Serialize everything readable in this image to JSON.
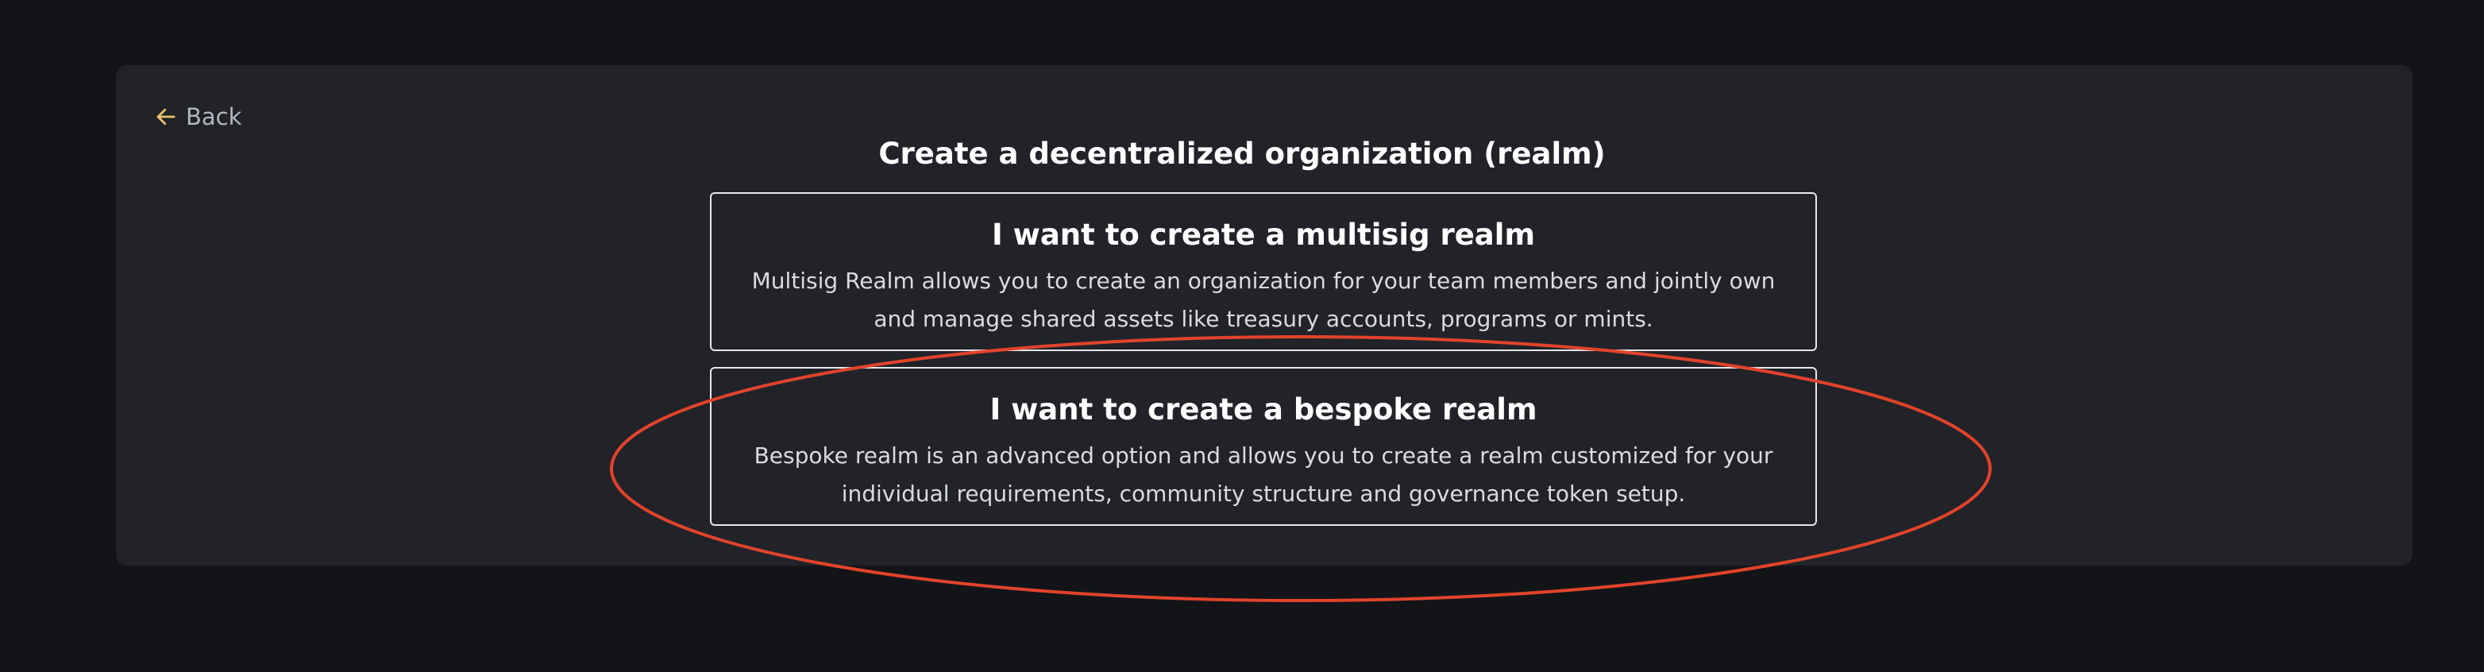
{
  "back": {
    "label": "Back",
    "icon": "arrow-left-icon",
    "icon_color": "#e9c46a"
  },
  "title": "Create a decentralized organization (realm)",
  "options": [
    {
      "title": "I want to create a multisig realm",
      "description": "Multisig Realm allows you to create an organization for your team members and jointly own and manage shared assets like treasury accounts, programs or mints."
    },
    {
      "title": "I want to create a bespoke realm",
      "description": "Bespoke realm is an advanced option and allows you to create a realm customized for your individual requirements, community structure and governance token setup."
    }
  ],
  "annotation": {
    "shape": "ellipse",
    "color": "#e2432a",
    "highlights": "bespoke realm option"
  },
  "colors": {
    "background": "#131418",
    "panel": "#212328",
    "text": "#ffffff"
  }
}
